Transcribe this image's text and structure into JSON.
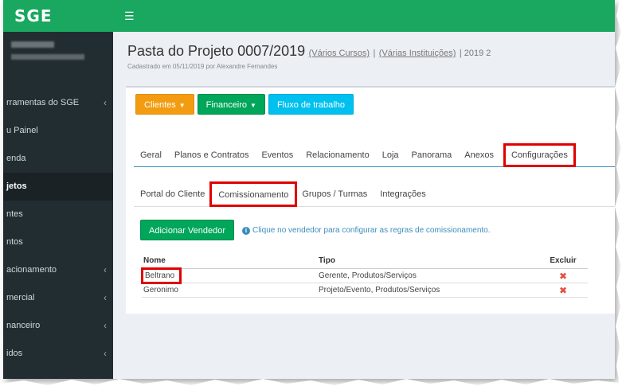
{
  "app": {
    "logo": "SGE"
  },
  "sidebar": {
    "items": [
      {
        "label": "rramentas do SGE",
        "chevron": "‹"
      },
      {
        "label": "u Painel",
        "chevron": ""
      },
      {
        "label": "enda",
        "chevron": ""
      },
      {
        "label": "jetos",
        "chevron": "",
        "active": true
      },
      {
        "label": "ntes",
        "chevron": ""
      },
      {
        "label": "ntos",
        "chevron": ""
      },
      {
        "label": "acionamento",
        "chevron": "‹"
      },
      {
        "label": "mercial",
        "chevron": "‹"
      },
      {
        "label": "nanceiro",
        "chevron": "‹"
      },
      {
        "label": "idos",
        "chevron": "‹"
      }
    ]
  },
  "header": {
    "title": "Pasta do Projeto 0007/2019",
    "link1": "(Vários Cursos)",
    "link2": "(Várias Instituições)",
    "year": "| 2019 2",
    "subtitle": "Cadastrado em 05/11/2019 por Alexandre Fernandes"
  },
  "toolbar": {
    "clientes": "Clientes",
    "financeiro": "Financeiro",
    "fluxo": "Fluxo de trabalho"
  },
  "tabs": [
    "Geral",
    "Planos e Contratos",
    "Eventos",
    "Relacionamento",
    "Loja",
    "Panorama",
    "Anexos",
    "Configurações"
  ],
  "subtabs": [
    "Portal do Cliente",
    "Comissionamento",
    "Grupos / Turmas",
    "Integrações"
  ],
  "actions": {
    "add_vendor": "Adicionar Vendedor",
    "info": "Clique no vendedor para configurar as regras de comissionamento."
  },
  "table": {
    "headers": {
      "nome": "Nome",
      "tipo": "Tipo",
      "excluir": "Excluir"
    },
    "rows": [
      {
        "nome": "Beltrano",
        "tipo": "Gerente, Produtos/Serviços"
      },
      {
        "nome": "Geronimo",
        "tipo": "Projeto/Evento, Produtos/Serviços"
      }
    ]
  },
  "colors": {
    "brand": "#1aa760",
    "sidebar": "#222d32",
    "highlight": "#e00000",
    "delete": "#e74c3c"
  }
}
